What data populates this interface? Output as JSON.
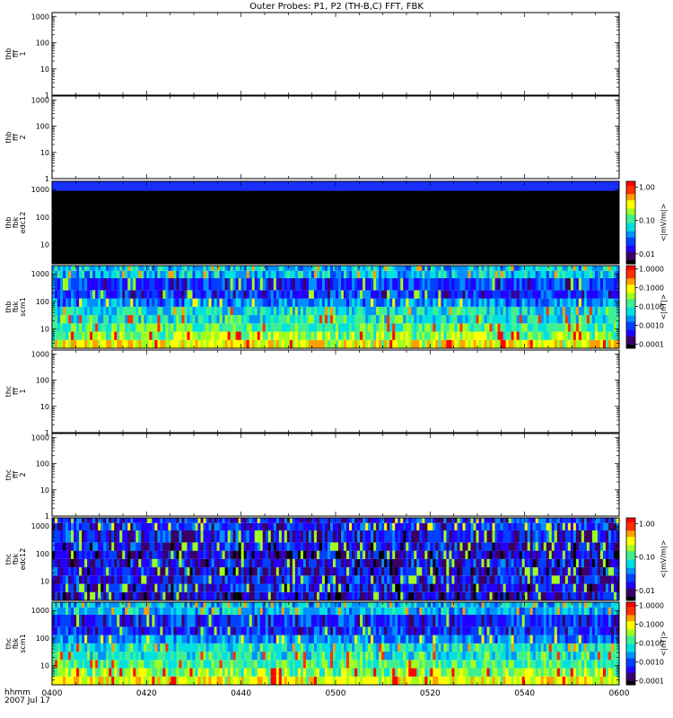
{
  "title": "Outer Probes: P1, P2 (TH-B,C) FFT, FBK",
  "time_axis": {
    "label_line1": "hhmm",
    "label_line2": "2007 Jul 17",
    "ticks": [
      "0400",
      "0420",
      "0440",
      "0500",
      "0520",
      "0540",
      "0600"
    ],
    "range": [
      "04:00",
      "06:00"
    ]
  },
  "chart_data": [
    {
      "type": "heatmap",
      "ylabel": [
        "thb",
        "fff",
        "1"
      ],
      "yscale": "log",
      "ylim": [
        1,
        1400
      ],
      "yticks": [
        "1",
        "10",
        "100",
        "1000"
      ],
      "content": "empty"
    },
    {
      "type": "heatmap",
      "ylabel": [
        "thb",
        "fff",
        "2"
      ],
      "yscale": "log",
      "ylim": [
        1,
        1400
      ],
      "yticks": [
        "1",
        "10",
        "100",
        "1000"
      ],
      "content": "empty"
    },
    {
      "type": "heatmap",
      "ylabel": [
        "thb",
        "fbk",
        "edc12"
      ],
      "yscale": "log",
      "ylim": [
        2,
        2000
      ],
      "yticks": [
        "10",
        "100",
        "1000"
      ],
      "content": "edc_b",
      "colorbar": {
        "label": "<|mV/m|>",
        "ticks": [
          "0.01",
          "0.10",
          "1.00"
        ],
        "range": [
          0.005,
          1.5
        ],
        "scale": "log"
      }
    },
    {
      "type": "heatmap",
      "ylabel": [
        "thb",
        "fbk",
        "scm1"
      ],
      "yscale": "log",
      "ylim": [
        2,
        2000
      ],
      "yticks": [
        "10",
        "100",
        "1000"
      ],
      "content": "scm_b",
      "colorbar": {
        "label": "<|nT|>",
        "ticks": [
          "0.0001",
          "0.0010",
          "0.0100",
          "0.1000",
          "1.0000"
        ],
        "range": [
          6e-05,
          1.5
        ],
        "scale": "log"
      }
    },
    {
      "type": "heatmap",
      "ylabel": [
        "thc",
        "fff",
        "1"
      ],
      "yscale": "log",
      "ylim": [
        1,
        1400
      ],
      "yticks": [
        "1",
        "10",
        "100",
        "1000"
      ],
      "content": "empty"
    },
    {
      "type": "heatmap",
      "ylabel": [
        "thc",
        "fff",
        "2"
      ],
      "yscale": "log",
      "ylim": [
        1,
        1400
      ],
      "yticks": [
        "1",
        "10",
        "100",
        "1000"
      ],
      "content": "empty"
    },
    {
      "type": "heatmap",
      "ylabel": [
        "thc",
        "fbk",
        "edc12"
      ],
      "yscale": "log",
      "ylim": [
        2,
        2000
      ],
      "yticks": [
        "10",
        "100",
        "1000"
      ],
      "content": "edc_c",
      "colorbar": {
        "label": "<|mV/m|>",
        "ticks": [
          "0.01",
          "0.10",
          "1.00"
        ],
        "range": [
          0.005,
          1.5
        ],
        "scale": "log"
      }
    },
    {
      "type": "heatmap",
      "ylabel": [
        "thc",
        "fbk",
        "scm1"
      ],
      "yscale": "log",
      "ylim": [
        2,
        2000
      ],
      "yticks": [
        "10",
        "100",
        "1000"
      ],
      "content": "scm_c",
      "colorbar": {
        "label": "<|nT|>",
        "ticks": [
          "0.0001",
          "0.0010",
          "0.0100",
          "0.1000",
          "1.0000"
        ],
        "range": [
          6e-05,
          1.5
        ],
        "scale": "log"
      }
    }
  ]
}
